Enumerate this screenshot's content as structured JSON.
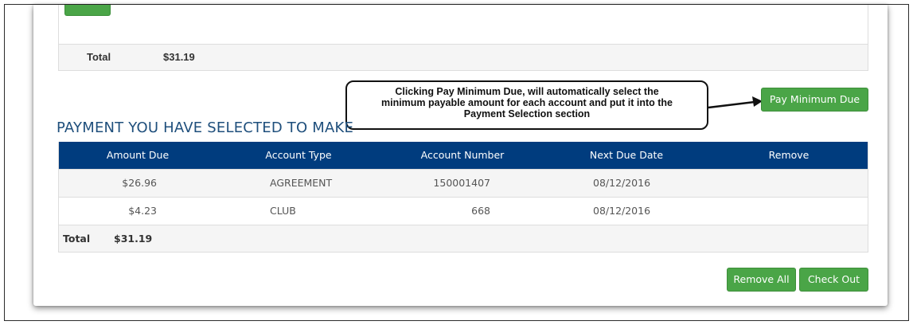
{
  "top_section": {
    "total_label": "Total",
    "total_value": "$31.19"
  },
  "callout": {
    "lines": [
      "Clicking Pay Minimum Due, will automatically select the",
      "minimum payable amount for each account and put it into the",
      "Payment Selection section"
    ]
  },
  "buttons": {
    "pay_minimum_due": "Pay Minimum Due",
    "remove_all": "Remove All",
    "check_out": "Check Out"
  },
  "payment_section": {
    "heading": "PAYMENT YOU HAVE SELECTED TO MAKE",
    "columns": [
      "Amount Due",
      "Account Type",
      "Account Number",
      "Next Due Date",
      "Remove"
    ],
    "rows": [
      {
        "amount_due": "$26.96",
        "account_type": "AGREEMENT",
        "account_number": "150001407",
        "next_due_date": "08/12/2016"
      },
      {
        "amount_due": "$4.23",
        "account_type": "CLUB",
        "account_number": "668",
        "next_due_date": "08/12/2016"
      }
    ],
    "total_label": "Total",
    "total_value": "$31.19"
  },
  "colors": {
    "header_bg": "#003c7e",
    "button_green": "#4aa547",
    "heading_blue": "#1f4f7c"
  }
}
